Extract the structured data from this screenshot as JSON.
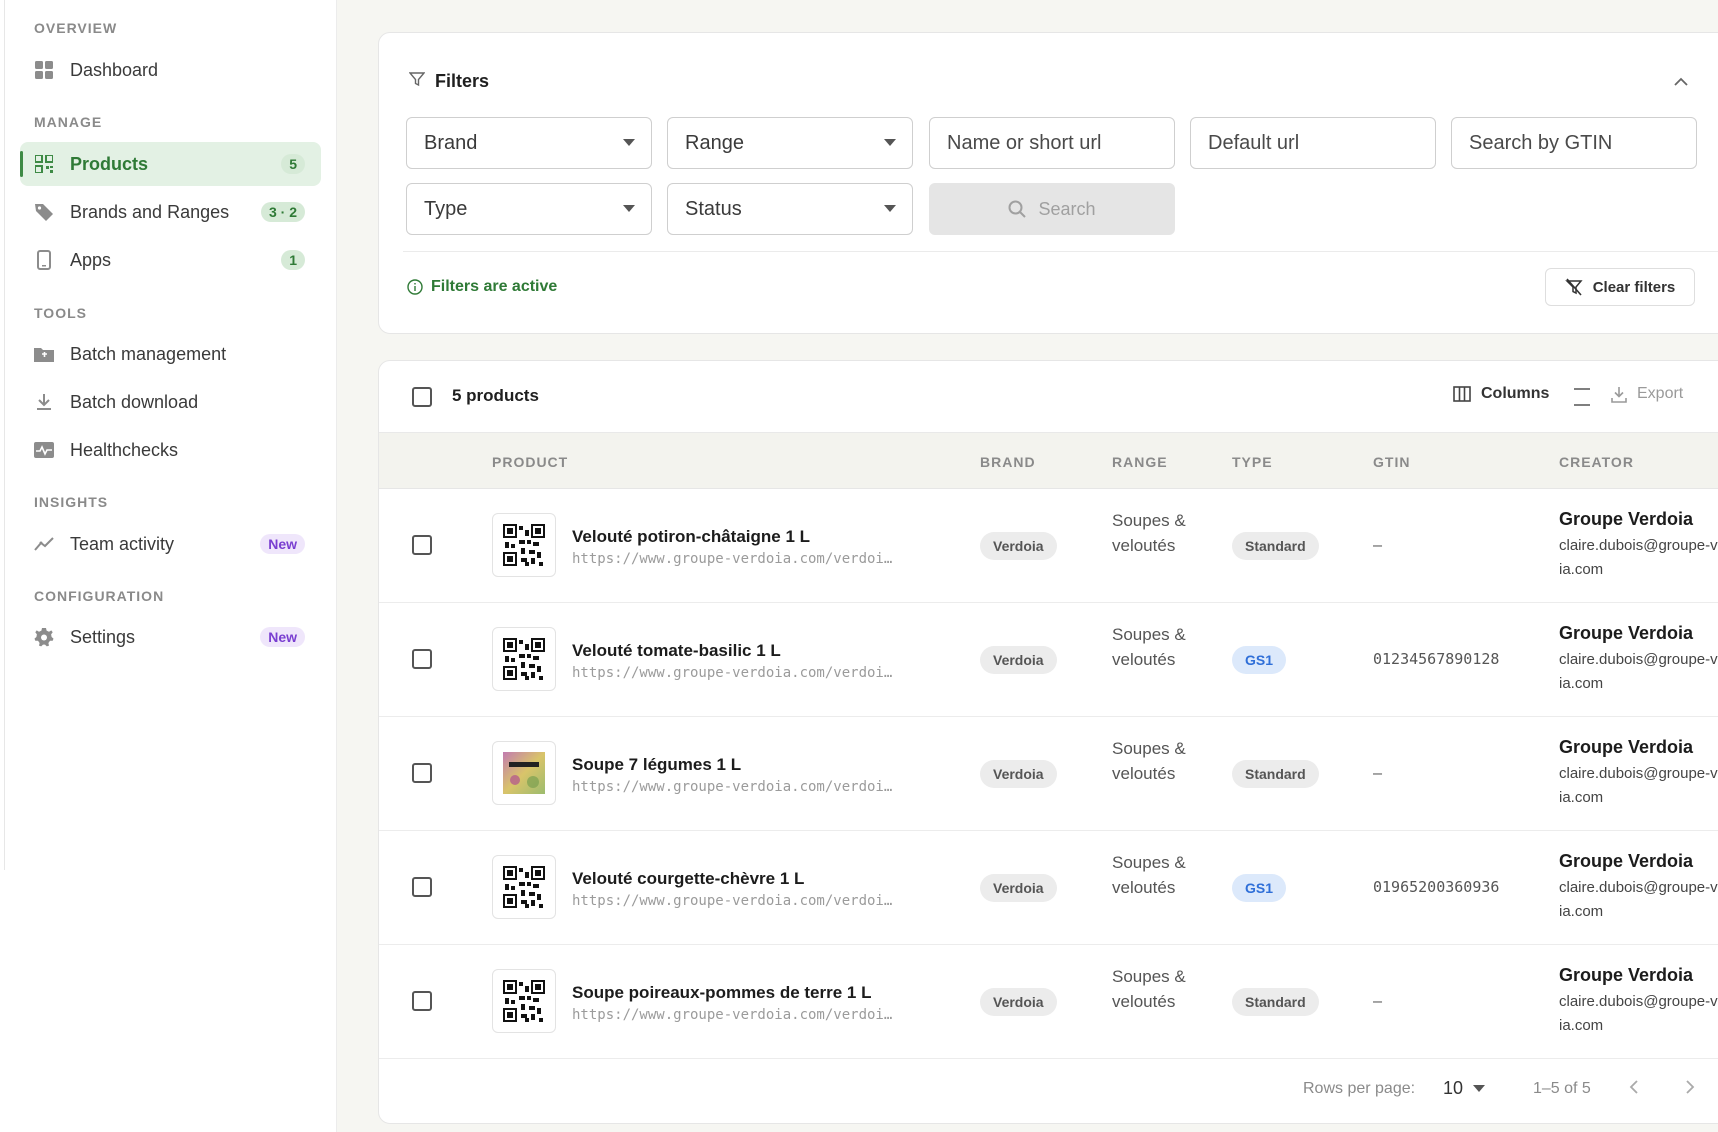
{
  "sidebar": {
    "sections": {
      "overview": "OVERVIEW",
      "manage": "MANAGE",
      "tools": "TOOLS",
      "insights": "INSIGHTS",
      "configuration": "CONFIGURATION"
    },
    "items": [
      {
        "label": "Dashboard",
        "icon": "grid-icon"
      },
      {
        "label": "Products",
        "icon": "qr-code-icon",
        "badge": "5",
        "active": true
      },
      {
        "label": "Brands and Ranges",
        "icon": "tag-icon",
        "badge": "3 · 2"
      },
      {
        "label": "Apps",
        "icon": "phone-icon",
        "badge": "1"
      },
      {
        "label": "Batch management",
        "icon": "folder-icon"
      },
      {
        "label": "Batch download",
        "icon": "download-icon"
      },
      {
        "label": "Healthchecks",
        "icon": "pulse-icon"
      },
      {
        "label": "Team activity",
        "icon": "activity-chart-icon",
        "badge": "New"
      },
      {
        "label": "Settings",
        "icon": "gear-icon",
        "badge": "New"
      }
    ]
  },
  "filters": {
    "title": "Filters",
    "brand": "Brand",
    "range": "Range",
    "name_placeholder": "Name or short url",
    "default_url_placeholder": "Default url",
    "gtin_placeholder": "Search by GTIN",
    "type": "Type",
    "status": "Status",
    "search_label": "Search",
    "active_text": "Filters are active",
    "clear_label": "Clear filters"
  },
  "table": {
    "count_label": "5 products",
    "columns_label": "Columns",
    "export_label": "Export",
    "headers": [
      "PRODUCT",
      "BRAND",
      "RANGE",
      "TYPE",
      "GTIN",
      "CREATOR"
    ],
    "rows": [
      {
        "name": "Velouté potiron-châtaigne 1 L",
        "url": "https://www.groupe-verdoia.com/verdoi…",
        "brand": "Verdoia",
        "range": "Soupes & veloutés",
        "type": "Standard",
        "gtin": "–",
        "creator": "Groupe Verdoia",
        "email": "claire.dubois@groupe-verdoia.com",
        "thumb": "qr"
      },
      {
        "name": "Velouté tomate-basilic 1 L",
        "url": "https://www.groupe-verdoia.com/verdoi…",
        "brand": "Verdoia",
        "range": "Soupes & veloutés",
        "type": "GS1",
        "gtin": "01234567890128",
        "creator": "Groupe Verdoia",
        "email": "claire.dubois@groupe-verdoia.com",
        "thumb": "qr"
      },
      {
        "name": "Soupe 7 légumes 1 L",
        "url": "https://www.groupe-verdoia.com/verdoi…",
        "brand": "Verdoia",
        "range": "Soupes & veloutés",
        "type": "Standard",
        "gtin": "–",
        "creator": "Groupe Verdoia",
        "email": "claire.dubois@groupe-verdoia.com",
        "thumb": "image"
      },
      {
        "name": "Velouté courgette-chèvre 1 L",
        "url": "https://www.groupe-verdoia.com/verdoi…",
        "brand": "Verdoia",
        "range": "Soupes & veloutés",
        "type": "GS1",
        "gtin": "01965200360936",
        "creator": "Groupe Verdoia",
        "email": "claire.dubois@groupe-verdoia.com",
        "thumb": "qr"
      },
      {
        "name": "Soupe poireaux-pommes de terre 1 L",
        "url": "https://www.groupe-verdoia.com/verdoi…",
        "brand": "Verdoia",
        "range": "Soupes & veloutés",
        "type": "Standard",
        "gtin": "–",
        "creator": "Groupe Verdoia",
        "email": "claire.dubois@groupe-verdoia.com",
        "thumb": "qr"
      }
    ]
  },
  "pagination": {
    "rows_per_page_label": "Rows per page:",
    "rows_per_page_value": "10",
    "range_label": "1–5 of 5"
  },
  "colors": {
    "accent": "#2f7a36",
    "active_bg": "#e3f1e4",
    "new_badge": "#7a3fd1",
    "gs1_badge": "#2f6fd8"
  }
}
